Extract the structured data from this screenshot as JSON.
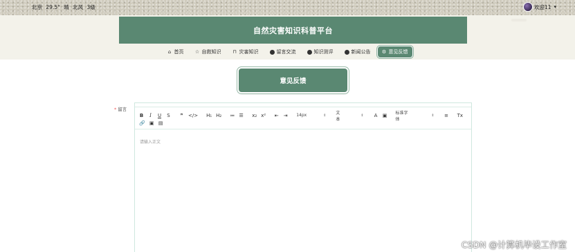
{
  "topbar": {
    "weather": {
      "city": "北京",
      "temp": "29.5°",
      "condition": "晴",
      "wind": "北风",
      "level": "3级"
    },
    "user": {
      "greeting": "欢迎11",
      "caret": "▾"
    }
  },
  "header": {
    "title": "自然灾害知识科普平台"
  },
  "nav": {
    "items": [
      {
        "label": "首页",
        "icon": "home-icon",
        "glyph": "⌂"
      },
      {
        "label": "自救知识",
        "icon": "star-icon",
        "glyph": "☆"
      },
      {
        "label": "灾害知识",
        "icon": "bag-icon",
        "glyph": "⊓"
      },
      {
        "label": "留言交流",
        "icon": "dot-icon",
        "glyph": "•"
      },
      {
        "label": "知识测评",
        "icon": "dot-icon",
        "glyph": "•"
      },
      {
        "label": "新闻公告",
        "icon": "dot-icon",
        "glyph": "•"
      },
      {
        "label": "意见反馈",
        "icon": "gear-icon",
        "glyph": "⚙"
      }
    ],
    "active_index": 6,
    "active_color": "#5a8872"
  },
  "page": {
    "heading": "意见反馈"
  },
  "form": {
    "field_label": "留言",
    "required_mark": "*",
    "editor": {
      "placeholder": "请输入正文",
      "toolbar": {
        "row1": [
          "B",
          "I",
          "U",
          "S",
          "❞",
          "</>",
          "H₁",
          "H₂",
          "≔",
          "☰",
          "x₂",
          "x²",
          "⇤",
          "⇥"
        ],
        "size_select": "14px",
        "text_select": "文本",
        "color_icons": [
          "A",
          "▣"
        ],
        "font_select": "标准字体",
        "align_icons": [
          "≡",
          "Tx"
        ],
        "row2": [
          "🔗",
          "▣",
          "▤"
        ]
      }
    }
  },
  "watermark": "CSDN @计算机毕设工作室",
  "colors": {
    "primary": "#5a8872",
    "header_bg": "#f3f2ea",
    "border": "#cfe7df"
  }
}
